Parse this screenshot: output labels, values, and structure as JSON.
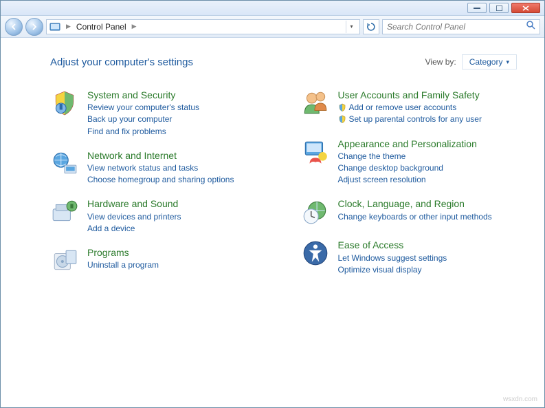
{
  "breadcrumb": {
    "root": "Control Panel"
  },
  "search": {
    "placeholder": "Search Control Panel"
  },
  "heading": "Adjust your computer's settings",
  "viewby": {
    "label": "View by:",
    "value": "Category"
  },
  "left": [
    {
      "title": "System and Security",
      "links": [
        "Review your computer's status",
        "Back up your computer",
        "Find and fix problems"
      ]
    },
    {
      "title": "Network and Internet",
      "links": [
        "View network status and tasks",
        "Choose homegroup and sharing options"
      ]
    },
    {
      "title": "Hardware and Sound",
      "links": [
        "View devices and printers",
        "Add a device"
      ]
    },
    {
      "title": "Programs",
      "links": [
        "Uninstall a program"
      ]
    }
  ],
  "right": [
    {
      "title": "User Accounts and Family Safety",
      "shielded": true,
      "links": [
        "Add or remove user accounts",
        "Set up parental controls for any user"
      ]
    },
    {
      "title": "Appearance and Personalization",
      "links": [
        "Change the theme",
        "Change desktop background",
        "Adjust screen resolution"
      ]
    },
    {
      "title": "Clock, Language, and Region",
      "links": [
        "Change keyboards or other input methods"
      ]
    },
    {
      "title": "Ease of Access",
      "links": [
        "Let Windows suggest settings",
        "Optimize visual display"
      ]
    }
  ],
  "watermark": "wsxdn.com"
}
